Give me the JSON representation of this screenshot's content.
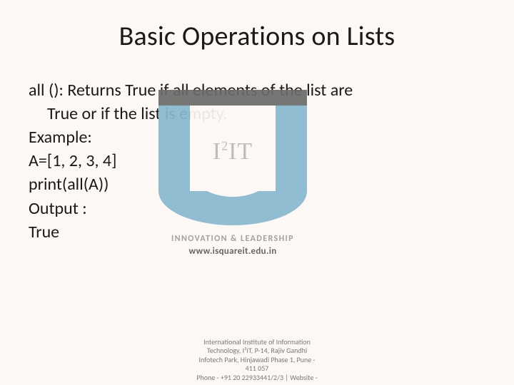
{
  "title": "Basic Operations on Lists",
  "body": {
    "line1": "all (): Returns True if all elements of the list are",
    "line1b": "True or if the list is empty.",
    "line2": "Example:",
    "line3": "A=[1, 2, 3, 4]",
    "line4": "print(all(A))",
    "line5": "Output :",
    "line6": "True"
  },
  "watermark": {
    "logo_text_prefix": "I",
    "logo_text_sup": "2",
    "logo_text_suffix": "IT",
    "tagline1": "INNOVATION & LEADERSHIP",
    "tagline2": "www.isquareit.edu.in"
  },
  "footer": {
    "l1": "International Institute of Information",
    "l2": "Technology, I²IT, P-14, Rajiv Gandhi",
    "l3": "Infotech Park, Hinjawadi Phase 1, Pune -",
    "l4": "411 057",
    "l5": "Phone - +91 20 22933441/2/3 | Website -"
  }
}
